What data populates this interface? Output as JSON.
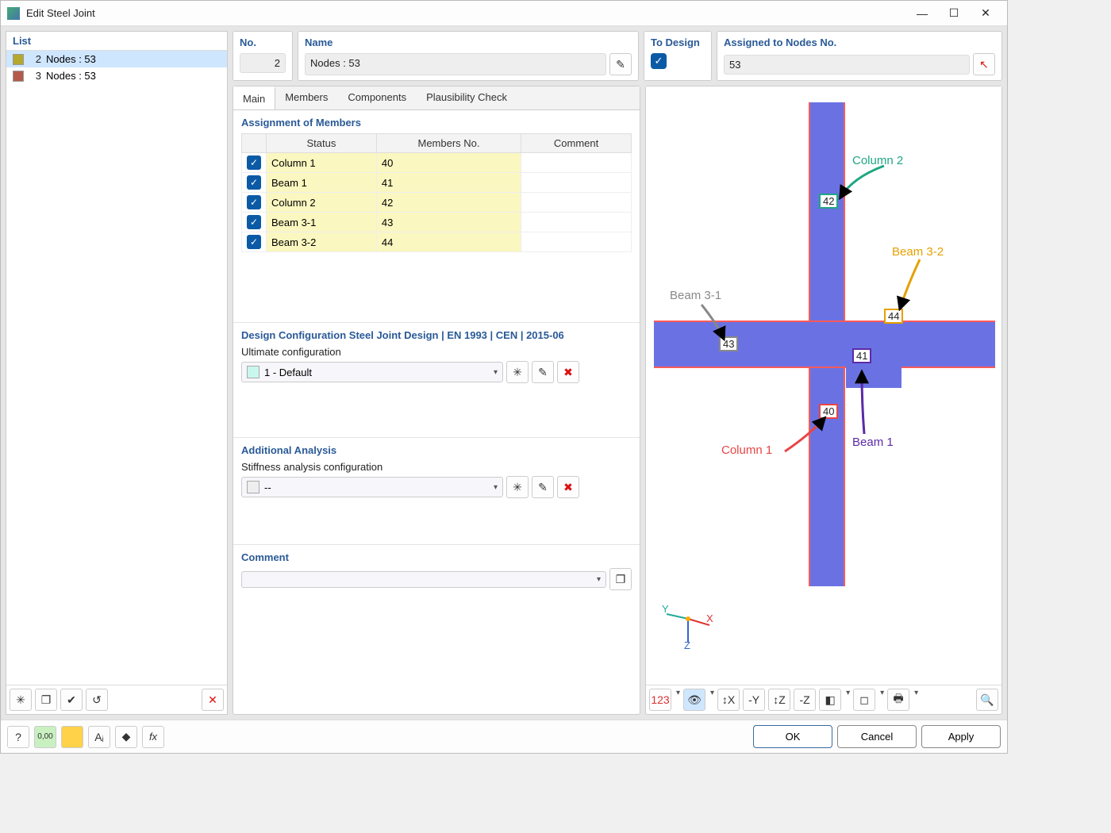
{
  "window": {
    "title": "Edit Steel Joint"
  },
  "list": {
    "header": "List",
    "items": [
      {
        "num": "2",
        "label": "Nodes : 53",
        "color": "#b4a82d",
        "selected": true
      },
      {
        "num": "3",
        "label": "Nodes : 53",
        "color": "#b45a4a",
        "selected": false
      }
    ]
  },
  "no": {
    "label": "No.",
    "value": "2"
  },
  "name": {
    "label": "Name",
    "value": "Nodes : 53"
  },
  "to_design": {
    "label": "To Design",
    "checked": true
  },
  "assigned": {
    "label": "Assigned to Nodes No.",
    "value": "53"
  },
  "tabs": {
    "items": [
      "Main",
      "Members",
      "Components",
      "Plausibility Check"
    ],
    "active": 0
  },
  "assignment": {
    "title": "Assignment of Members",
    "columns": [
      "",
      "Status",
      "Members No.",
      "Comment"
    ],
    "rows": [
      {
        "checked": true,
        "status": "Column 1",
        "members_no": "40",
        "comment": ""
      },
      {
        "checked": true,
        "status": "Beam 1",
        "members_no": "41",
        "comment": ""
      },
      {
        "checked": true,
        "status": "Column 2",
        "members_no": "42",
        "comment": ""
      },
      {
        "checked": true,
        "status": "Beam 3-1",
        "members_no": "43",
        "comment": ""
      },
      {
        "checked": true,
        "status": "Beam 3-2",
        "members_no": "44",
        "comment": ""
      }
    ]
  },
  "design_config": {
    "title": "Design Configuration Steel Joint Design | EN 1993 | CEN | 2015-06",
    "ultimate_label": "Ultimate configuration",
    "ultimate_value": "1 - Default"
  },
  "additional": {
    "title": "Additional Analysis",
    "stiff_label": "Stiffness analysis configuration",
    "stiff_value": "--"
  },
  "comment": {
    "title": "Comment",
    "value": ""
  },
  "viewer": {
    "labels": {
      "col1": "Column 1",
      "col2": "Column 2",
      "beam1": "Beam 1",
      "beam31": "Beam 3-1",
      "beam32": "Beam 3-2"
    },
    "tags": {
      "n40": "40",
      "n41": "41",
      "n42": "42",
      "n43": "43",
      "n44": "44"
    },
    "axes": {
      "x": "X",
      "y": "Y",
      "z": "Z"
    }
  },
  "buttons": {
    "ok": "OK",
    "cancel": "Cancel",
    "apply": "Apply"
  }
}
